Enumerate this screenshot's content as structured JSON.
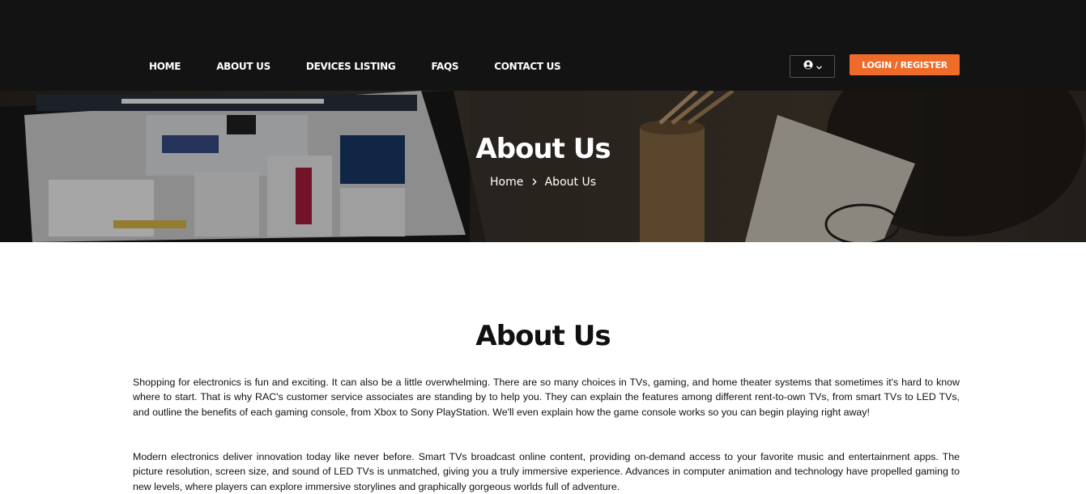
{
  "nav": {
    "items": [
      "HOME",
      "ABOUT US",
      "DEVICES LISTING",
      "FAQS",
      "CONTACT US"
    ],
    "login_label": "LOGIN / REGISTER",
    "accent": "#ef6b29"
  },
  "banner": {
    "title": "About Us",
    "breadcrumb": [
      "Home",
      "About Us"
    ]
  },
  "content": {
    "title": "About Us",
    "paragraphs": [
      "Shopping for electronics is fun and exciting. It can also be a little overwhelming. There are so many choices in TVs, gaming, and home theater systems that sometimes it's hard to know where to start. That is why RAC's customer service associates are standing by to help you. They can explain the features among different rent-to-own TVs, from smart TVs to LED TVs, and outline the benefits of each gaming console, from Xbox to Sony PlayStation. We'll even explain how the game console works so you can begin playing right away!",
      "Modern electronics deliver innovation today like never before. Smart TVs broadcast online content, providing on-demand access to your favorite music and entertainment apps. The picture resolution, screen size, and sound of LED TVs is unmatched, giving you a truly immersive experience. Advances in computer animation and technology have propelled gaming to new levels, where players can explore immersive storylines and graphically gorgeous worlds full of adventure."
    ]
  },
  "icons": {
    "user": "user-circle-icon",
    "chevron": "chevron-down-icon",
    "crumb_sep": "chevron-right-icon"
  }
}
